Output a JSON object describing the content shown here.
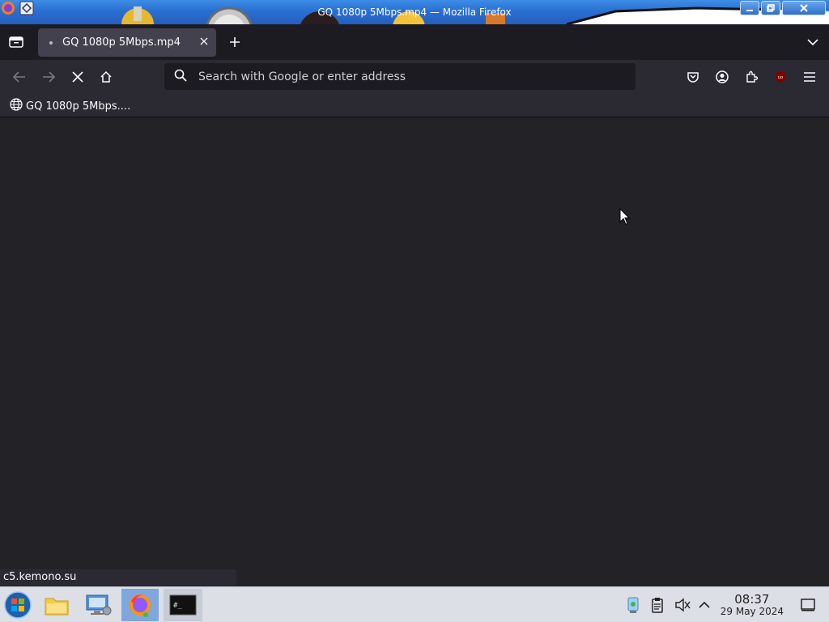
{
  "window": {
    "title": "GQ 1080p 5Mbps.mp4 — Mozilla Firefox",
    "controls": [
      "minimize",
      "restore",
      "close"
    ]
  },
  "tabs": [
    {
      "label": "GQ 1080p 5Mbps.mp4",
      "active": true
    }
  ],
  "navbar": {
    "search_placeholder": "Search with Google or enter address"
  },
  "bookmarks": [
    {
      "label": "GQ 1080p 5Mbps...."
    }
  ],
  "status_link": "c5.kemono.su",
  "taskbar": {
    "apps": [
      "start-button",
      "file-manager",
      "system-settings",
      "firefox",
      "terminal"
    ],
    "active_app": "firefox",
    "tray_icons": [
      "network-icon",
      "clipboard-icon",
      "speaker-muted-icon",
      "tray-expand-icon"
    ],
    "clock": {
      "time": "08:37",
      "date": "29 May 2024"
    }
  },
  "colors": {
    "accent": "#2a6fd0",
    "content_bg": "#232227",
    "toolbar_bg": "#2b2a33",
    "tab_active_bg": "#42414d"
  }
}
